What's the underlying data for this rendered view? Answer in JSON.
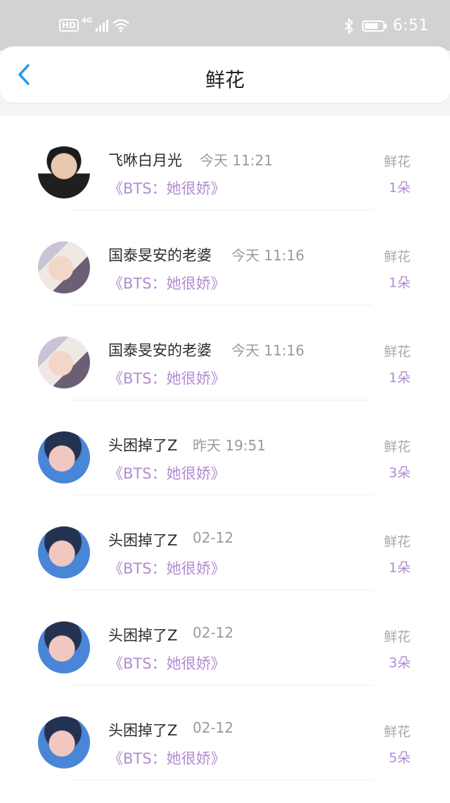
{
  "status_bar": {
    "hd": "HD",
    "network": "4G",
    "time": "6:51",
    "battery_level": 0.75
  },
  "nav": {
    "title": "鲜花"
  },
  "list": {
    "items": [
      {
        "username": "飞咻白月光",
        "time": "今天 11:21",
        "book": "《BTS：她很娇》",
        "type": "鲜花",
        "count": "1朵"
      },
      {
        "username": "国泰旻安的老婆",
        "time": "今天 11:16",
        "book": "《BTS：她很娇》",
        "type": "鲜花",
        "count": "1朵"
      },
      {
        "username": "国泰旻安的老婆",
        "time": "今天 11:16",
        "book": "《BTS：她很娇》",
        "type": "鲜花",
        "count": "1朵"
      },
      {
        "username": "头困掉了Z",
        "time": "昨天 19:51",
        "book": "《BTS：她很娇》",
        "type": "鲜花",
        "count": "3朵"
      },
      {
        "username": "头困掉了Z",
        "time": "02-12",
        "book": "《BTS：她很娇》",
        "type": "鲜花",
        "count": "1朵"
      },
      {
        "username": "头困掉了Z",
        "time": "02-12",
        "book": "《BTS：她很娇》",
        "type": "鲜花",
        "count": "3朵"
      },
      {
        "username": "头困掉了Z",
        "time": "02-12",
        "book": "《BTS：她很娇》",
        "type": "鲜花",
        "count": "5朵"
      }
    ]
  },
  "colors": {
    "accent_purple": "#b28bd3",
    "back_blue": "#1b9af0",
    "status_bar_bg": "#d2d2d2"
  }
}
